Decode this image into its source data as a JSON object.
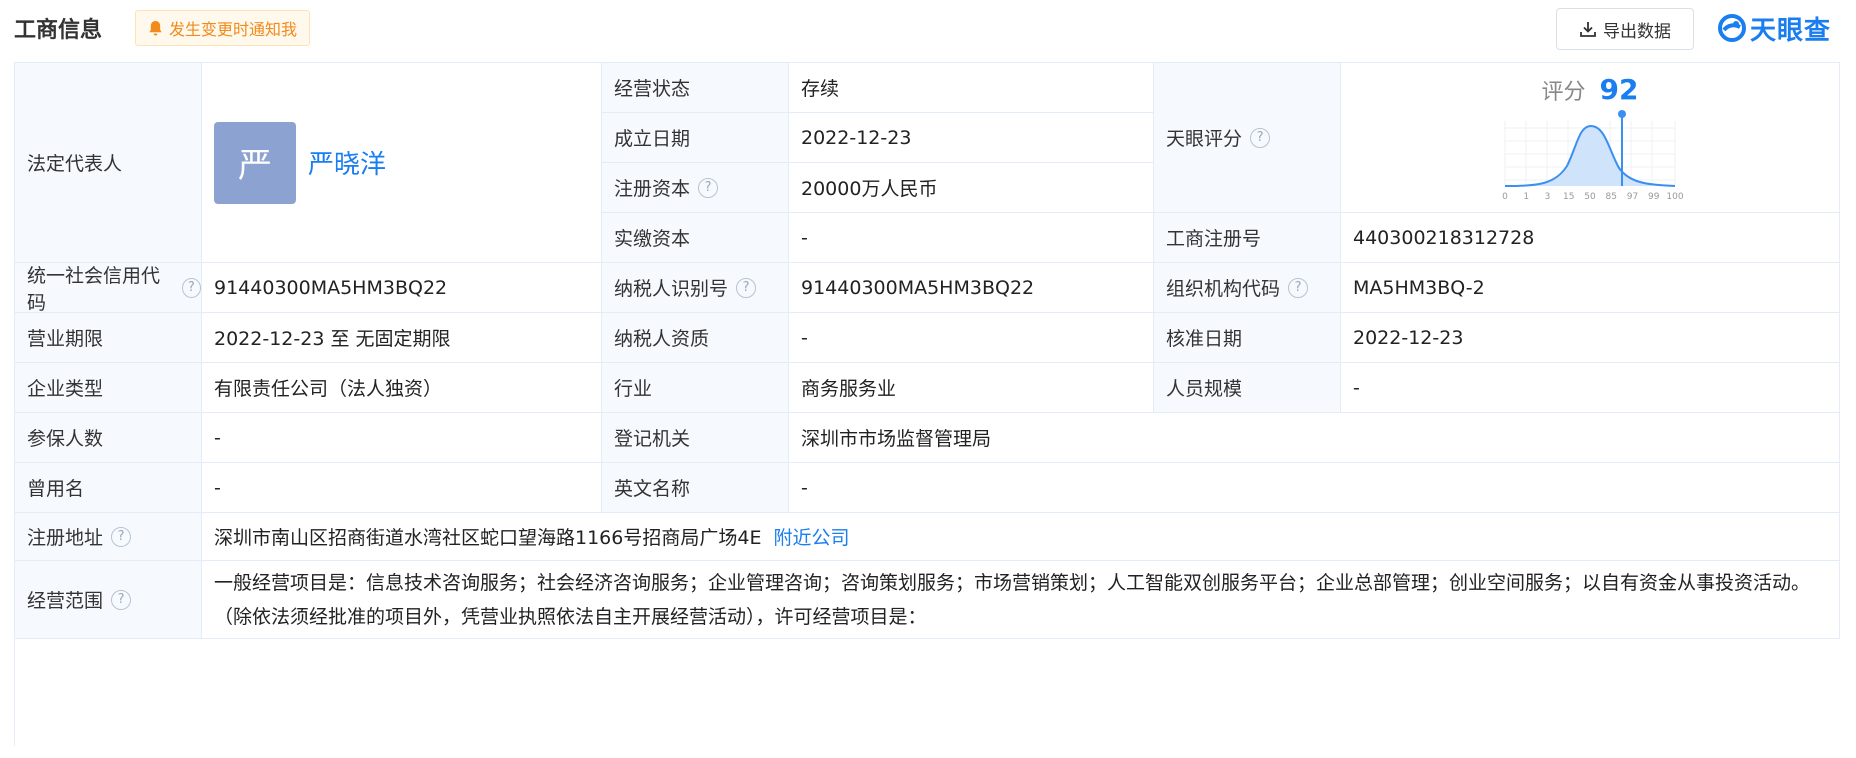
{
  "header": {
    "title": "工商信息",
    "notify_label": "发生变更时通知我",
    "export_label": "导出数据",
    "logo_text": "天眼查"
  },
  "legal_rep": {
    "label": "法定代表人",
    "avatar_char": "严",
    "name": "严晓洋"
  },
  "status": {
    "label": "经营状态",
    "value": "存续"
  },
  "founded": {
    "label": "成立日期",
    "value": "2022-12-23"
  },
  "reg_capital": {
    "label": "注册资本",
    "value": "20000万人民币"
  },
  "paid_capital": {
    "label": "实缴资本",
    "value": "-"
  },
  "tianyan_score": {
    "label": "天眼评分",
    "score_label": "评分",
    "score": "92",
    "axis_ticks": [
      "0",
      "1",
      "3",
      "15",
      "50",
      "85",
      "97",
      "99",
      "100"
    ]
  },
  "biz_reg_no": {
    "label": "工商注册号",
    "value": "440300218312728"
  },
  "credit_code": {
    "label": "统一社会信用代码",
    "value": "91440300MA5HM3BQ22"
  },
  "taxpayer_id": {
    "label": "纳税人识别号",
    "value": "91440300MA5HM3BQ22"
  },
  "org_code": {
    "label": "组织机构代码",
    "value": "MA5HM3BQ-2"
  },
  "term": {
    "label": "营业期限",
    "value": "2022-12-23 至 无固定期限"
  },
  "taxpayer_qual": {
    "label": "纳税人资质",
    "value": "-"
  },
  "approval_date": {
    "label": "核准日期",
    "value": "2022-12-23"
  },
  "company_type": {
    "label": "企业类型",
    "value": "有限责任公司（法人独资）"
  },
  "industry": {
    "label": "行业",
    "value": "商务服务业"
  },
  "staff_size": {
    "label": "人员规模",
    "value": "-"
  },
  "insured": {
    "label": "参保人数",
    "value": "-"
  },
  "reg_authority": {
    "label": "登记机关",
    "value": "深圳市市场监督管理局"
  },
  "former_name": {
    "label": "曾用名",
    "value": "-"
  },
  "english_name": {
    "label": "英文名称",
    "value": "-"
  },
  "address": {
    "label": "注册地址",
    "value": "深圳市南山区招商街道水湾社区蛇口望海路1166号招商局广场4E",
    "nearby_label": "附近公司"
  },
  "scope": {
    "label": "经营范围",
    "value": "一般经营项目是：信息技术咨询服务；社会经济咨询服务；企业管理咨询；咨询策划服务；市场营销策划；人工智能双创服务平台；企业总部管理；创业空间服务；以自有资金从事投资活动。（除依法须经批准的项目外，凭营业执照依法自主开展经营活动），许可经营项目是："
  },
  "help_icon_char": "?"
}
